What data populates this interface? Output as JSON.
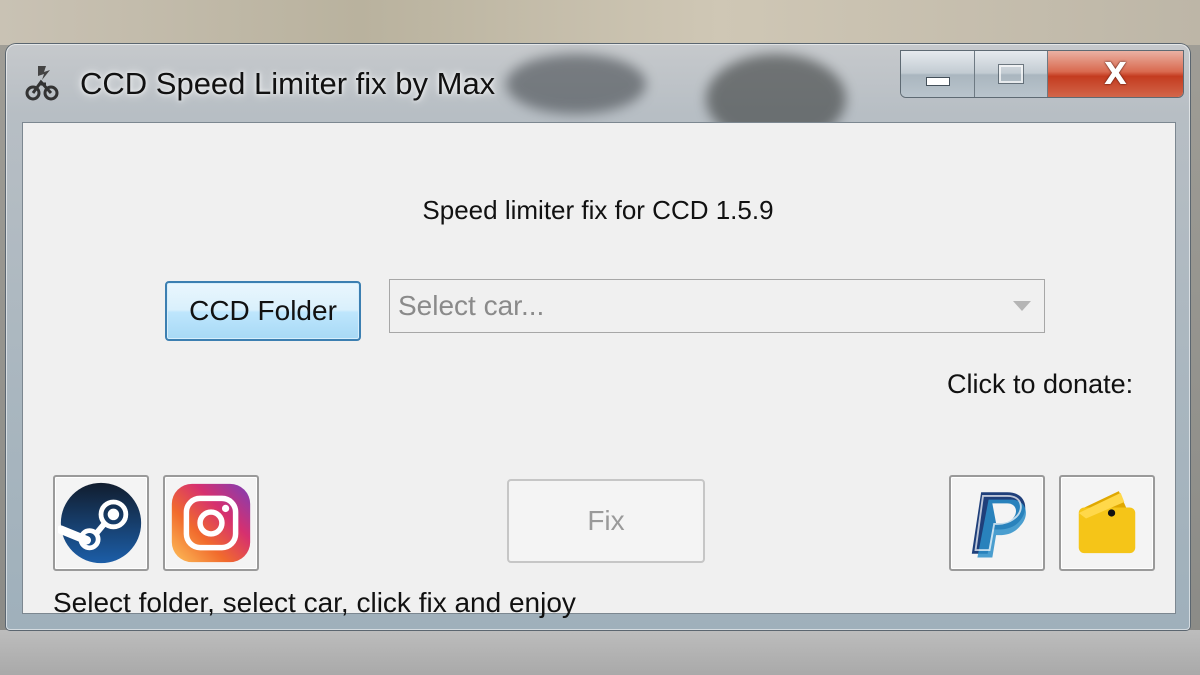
{
  "window": {
    "title": "CCD Speed Limiter fix by Max",
    "icon": "app-logo-icon",
    "controls": {
      "minimize_icon": "minimize-icon",
      "maximize_icon": "maximize-icon",
      "close_icon": "close-icon",
      "close_glyph": "X"
    }
  },
  "main": {
    "version_label": "Speed limiter fix for CCD 1.5.9",
    "folder_button_label": "CCD Folder",
    "car_select": {
      "placeholder": "Select car...",
      "enabled": false,
      "icon": "chevron-down-icon"
    },
    "donate_label": "Click to donate:",
    "fix_button_label": "Fix",
    "fix_button_enabled": false,
    "instructions": "Select folder, select car, click fix and enjoy"
  },
  "social_links": [
    {
      "icon": "steam-icon",
      "color": "#1b3b6f"
    },
    {
      "icon": "instagram-icon",
      "color": "#d6306f"
    }
  ],
  "donate_links": [
    {
      "icon": "paypal-icon",
      "color": "#253b80"
    },
    {
      "icon": "wallet-icon",
      "color": "#f5c518"
    }
  ]
}
